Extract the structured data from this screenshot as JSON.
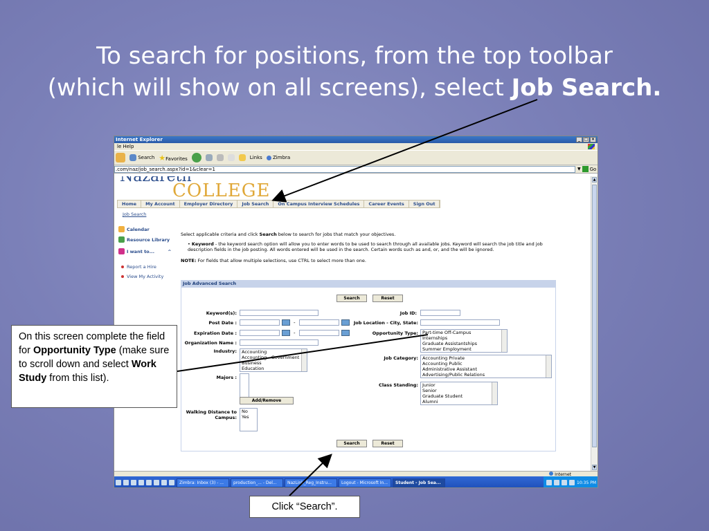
{
  "slide": {
    "title_line1": "To search for positions, from the top toolbar",
    "title_line2_pre": "(which will show on all screens), select ",
    "title_line2_bold": "Job Search.",
    "callout_opportunity": {
      "t1": "On this screen complete the field for ",
      "b1": "Opportunity Type",
      "t2": " (make sure to scroll down and select ",
      "b2": "Work Study",
      "t3": " from this list)."
    },
    "callout_search": "Click “Search”."
  },
  "browser": {
    "window_title": "Internet Explorer",
    "menu_text": "le   Help",
    "toolbar": {
      "search": "Search",
      "favorites": "Favorites",
      "links": "Links",
      "zimbra": "Zimbra"
    },
    "address": ".com/naz/job_search.aspx?id=1&clear=1",
    "go": "Go",
    "status_zone": "Internet",
    "taskbar": {
      "tasks": [
        "Zimbra: Inbox (3) - ...",
        "production_... - Del...",
        "NazLink_Reg_Instru...",
        "Logout - Microsoft In...",
        "Student - Job Sea..."
      ],
      "clock": "10:35 PM"
    }
  },
  "site": {
    "logo_top": "Nazareth",
    "logo_college": "COLLEGE",
    "nav": [
      "Home",
      "My Account",
      "Employer Directory",
      "Job Search",
      "On Campus Interview Schedules",
      "Career Events",
      "Sign Out"
    ],
    "breadcrumb": "Job Search",
    "sidebar": {
      "calendar": "Calendar",
      "resource_library": "Resource Library",
      "i_want_to": "I want to...",
      "links": [
        "Report a Hire",
        "View My Activity"
      ]
    },
    "intro_pre": "Select applicable criteria and click ",
    "intro_bold": "Search",
    "intro_post": " below to search for jobs that match your objectives.",
    "keyword_bold": "Keyword",
    "keyword_text": " - the keyword search option will allow you to enter words to be used to search through all available jobs. Keyword will search the job title and job description fields in the job posting. All words entered will be used in the search. Certain words such as and, or, and the will be ignored.",
    "note_bold": "NOTE:",
    "note_text": " For fields that allow multiple selections, use CTRL to select more than one.",
    "advanced_heading": "Job Advanced Search",
    "buttons": {
      "search": "Search",
      "reset": "Reset",
      "add_remove": "Add/Remove"
    },
    "labels": {
      "keyword": "Keyword(s):",
      "post_date": "Post Date :",
      "expiration_date": "Expiration Date :",
      "organization": "Organization Name :",
      "industry": "Industry:",
      "majors": "Majors :",
      "walking": "Walking Distance to",
      "campus": "Campus:",
      "job_id": "Job ID:",
      "job_location": "Job Location - City, State:",
      "opportunity_type": "Opportunity Type:",
      "job_category": "Job Category:",
      "class_standing": "Class Standing:",
      "dash": "-"
    },
    "lists": {
      "industry": [
        "Accounting",
        "Accounting - Government",
        "Business",
        "Education"
      ],
      "walking": [
        "No",
        "Yes"
      ],
      "opportunity": [
        "Part-time Off-Campus",
        "Internships",
        "Graduate Assistantships",
        "Summer Employment"
      ],
      "job_category": [
        "Accounting Private",
        "Accounting Public",
        "Administrative Assistant",
        "Advertising/Public Relations"
      ],
      "class_standing": [
        "Junior",
        "Senior",
        "Graduate Student",
        "Alumni"
      ]
    }
  },
  "colors": {
    "arrow": "#000000",
    "slide_bg": "#7b80b8",
    "logo_gold": "#e0a838",
    "nav_blue": "#2b4d8c"
  }
}
